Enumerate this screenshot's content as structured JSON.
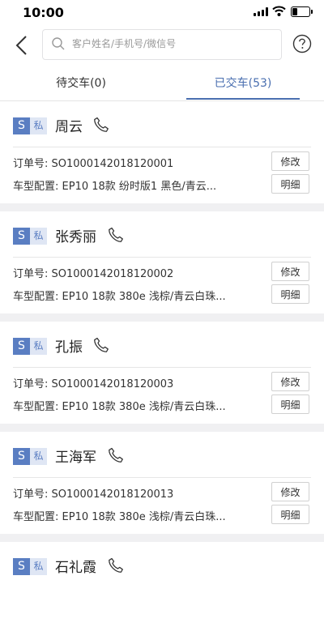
{
  "status_bar": {
    "time": "10:00"
  },
  "search": {
    "placeholder": "客户姓名/手机号/微信号"
  },
  "tabs": [
    {
      "label": "待交车(0)",
      "active": false
    },
    {
      "label": "已交车(53)",
      "active": true
    }
  ],
  "colors": {
    "accent": "#4a6fb0",
    "badge": "#5a7ec2"
  },
  "badges": {
    "type": "S",
    "owner": "私"
  },
  "orders": [
    {
      "name": "周云",
      "order_label": "订单号: SO1000142018120001",
      "config_label": "车型配置: EP10 18款 纷时版1 黑色/青云...",
      "edit_label": "修改",
      "detail_label": "明细"
    },
    {
      "name": "张秀丽",
      "order_label": "订单号: SO1000142018120002",
      "config_label": "车型配置: EP10 18款 380e 浅棕/青云白珠...",
      "edit_label": "修改",
      "detail_label": "明细"
    },
    {
      "name": "孔振",
      "order_label": "订单号: SO1000142018120003",
      "config_label": "车型配置: EP10 18款 380e 浅棕/青云白珠...",
      "edit_label": "修改",
      "detail_label": "明细"
    },
    {
      "name": "王海军",
      "order_label": "订单号: SO1000142018120013",
      "config_label": "车型配置: EP10 18款 380e 浅棕/青云白珠...",
      "edit_label": "修改",
      "detail_label": "明细"
    },
    {
      "name": "石礼霞"
    }
  ]
}
